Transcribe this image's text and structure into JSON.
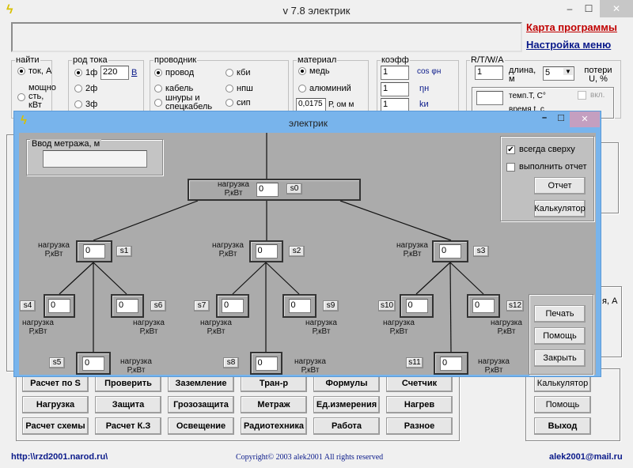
{
  "window": {
    "title": "v 7.8 электрик",
    "minimize": "‒",
    "maximize": "☐",
    "close": "✕"
  },
  "links": {
    "map": "Карта программы",
    "menu_settings": "Настройка меню"
  },
  "colors": {
    "link_red": "#c00000",
    "link_blue": "#0a1a8a",
    "dialog_frame": "#78b4ec",
    "dialog_bg": "#ababab"
  },
  "groups": {
    "find": {
      "legend": "найти",
      "options": [
        "ток, А",
        "мощно сть, кВт"
      ]
    },
    "current": {
      "legend": "род тока",
      "options": [
        "1ф",
        "2ф",
        "3ф"
      ],
      "voltage": "220",
      "unit": "В"
    },
    "conductor": {
      "legend": "проводник",
      "options": [
        "провод",
        "кабель",
        "шнуры и спецкабель",
        "кби",
        "нпш",
        "сип"
      ]
    },
    "material": {
      "legend": "материал",
      "options": [
        "медь",
        "алюминий"
      ],
      "rho": "0,0175",
      "rho_unit": "Р, ом м"
    },
    "coef": {
      "legend": "коэфф",
      "values": [
        "1",
        "1",
        "1"
      ],
      "labels": [
        "cos φн",
        "ηн",
        "kи"
      ]
    },
    "rtwa": {
      "legend": "R/T/W/A",
      "length": "1",
      "length_label": "длина, м",
      "loss_select": "5",
      "loss_label": "потери U, %",
      "temp_label": "темп.T, C°",
      "time_label": "время t, с",
      "enable": "вкл."
    }
  },
  "right_partial": {
    "label": "я, А"
  },
  "buttons": {
    "row1": [
      "Расчет по S",
      "Проверить",
      "Заземление",
      "Тран-р",
      "Формулы",
      "Счетчик"
    ],
    "row2": [
      "Нагрузка",
      "Защита",
      "Грозозащита",
      "Метраж",
      "Ед.измерения",
      "Нагрев"
    ],
    "row3": [
      "Расчет схемы",
      "Расчет К.З",
      "Освещение",
      "Радиотехника",
      "Работа",
      "Разное"
    ],
    "side": [
      "Калькулятор",
      "Помощь",
      "Выход"
    ]
  },
  "footer": {
    "site": "http:\\\\rzd2001.narod.ru\\",
    "copyright": "Copyright© 2003 alek2001 All rights reserved",
    "email": "alek2001@mail.ru"
  },
  "dialog": {
    "title": "электрик",
    "meter_legend": "Ввод метража, м",
    "meter_value": "",
    "always_on_top": {
      "label": "всегда сверху",
      "checked": true
    },
    "do_report": {
      "label": "выполнить отчет",
      "checked": false
    },
    "report_btn": "Отчет",
    "calc_btn": "Калькулятор",
    "print_btn": "Печать",
    "help_btn": "Помощь",
    "close_btn": "Закрыть",
    "node_label": "нагрузка",
    "node_unit": "Р,кВт",
    "nodes": [
      {
        "switch": "s0",
        "value": "0"
      },
      {
        "switch": "s1",
        "value": "0"
      },
      {
        "switch": "s2",
        "value": "0"
      },
      {
        "switch": "s3",
        "value": "0"
      },
      {
        "switch": "s4",
        "value": "0"
      },
      {
        "switch": "s5",
        "value": "0"
      },
      {
        "switch": "s6",
        "value": "0"
      },
      {
        "switch": "s7",
        "value": "0"
      },
      {
        "switch": "s8",
        "value": "0"
      },
      {
        "switch": "s9",
        "value": "0"
      },
      {
        "switch": "s10",
        "value": "0"
      },
      {
        "switch": "s11",
        "value": "0"
      },
      {
        "switch": "s12",
        "value": "0"
      }
    ]
  }
}
